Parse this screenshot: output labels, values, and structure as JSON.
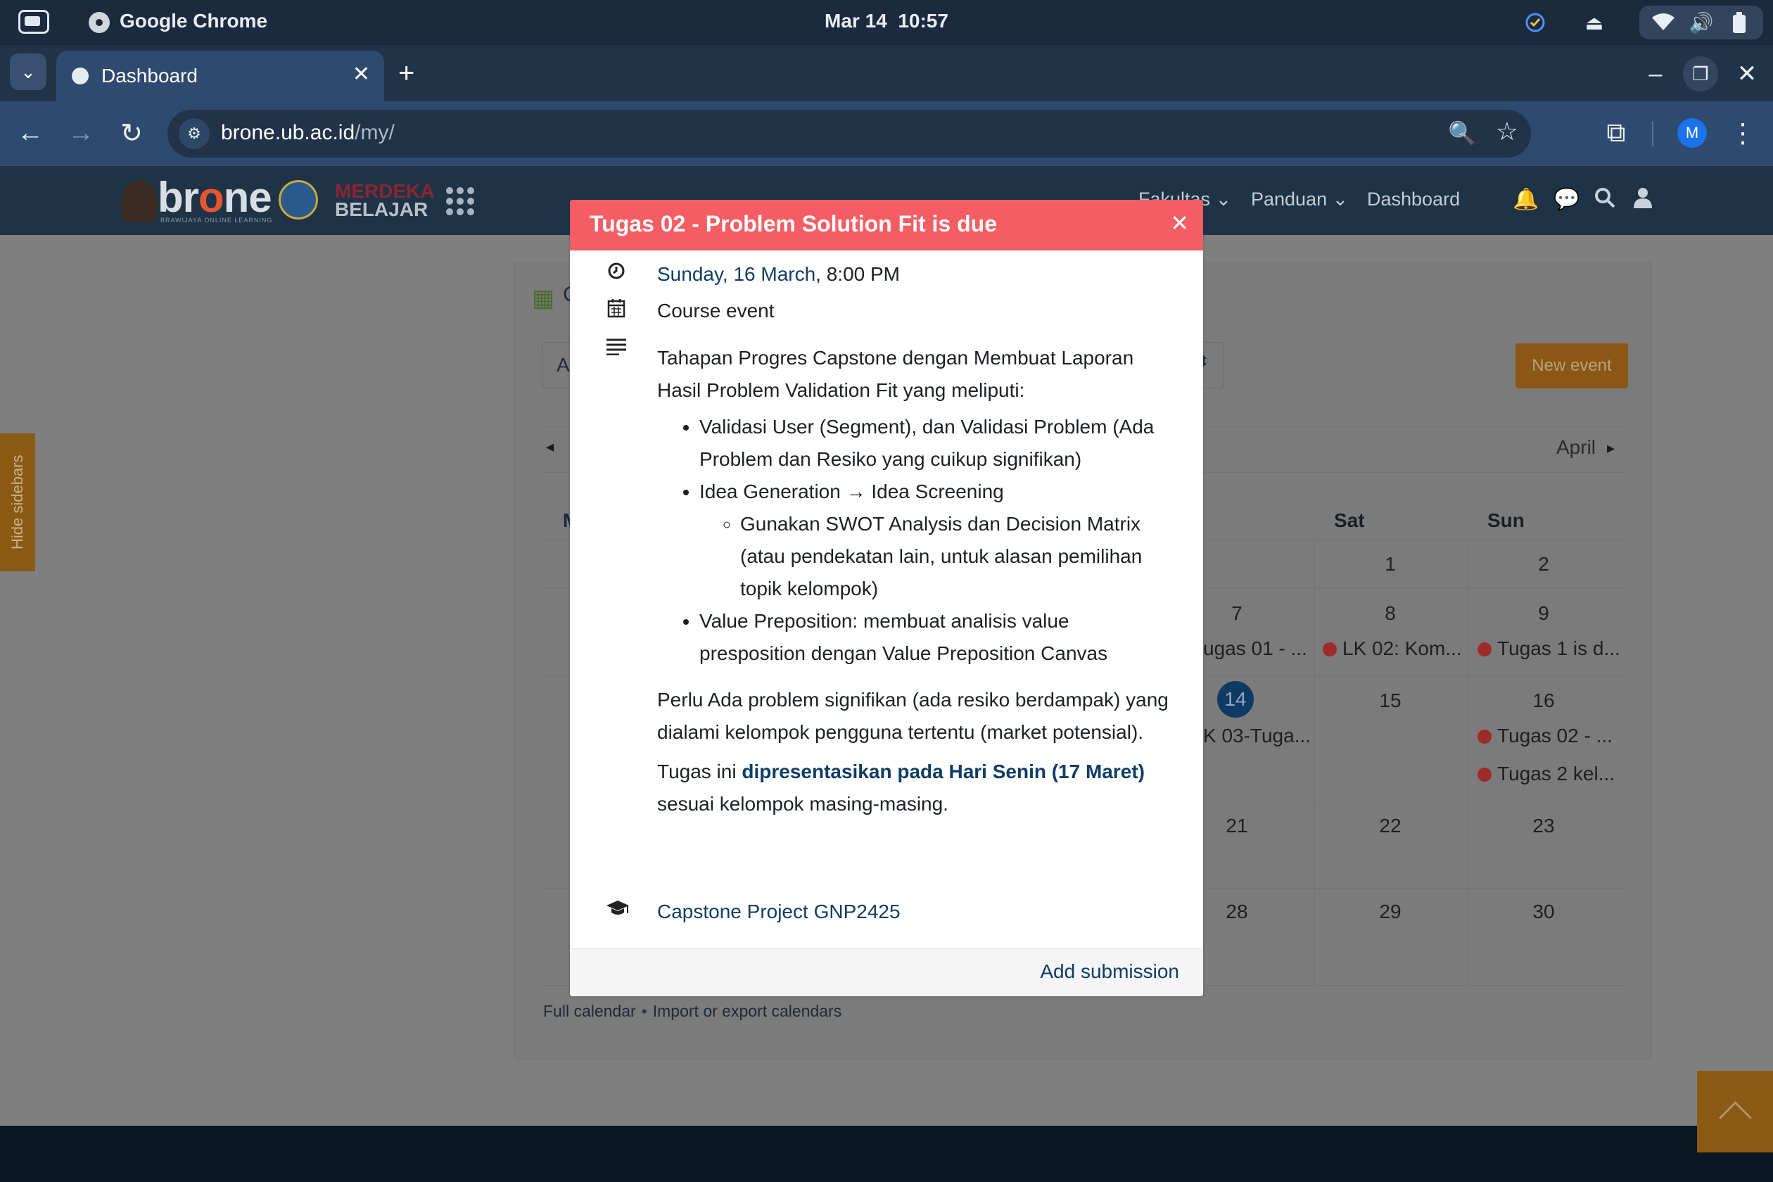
{
  "os": {
    "app_name": "Google Chrome",
    "date": "Mar 14",
    "time": "10:57",
    "icons": [
      "launcher-icon",
      "check-circle-icon",
      "eject-icon",
      "wifi-icon",
      "volume-icon",
      "battery-icon"
    ]
  },
  "browser": {
    "tab_title": "Dashboard",
    "url_host": "brone.ub.ac.id",
    "url_path": "/my/",
    "profile_initial": "M"
  },
  "site": {
    "logo_text_pre": "br",
    "logo_text_o": "o",
    "logo_text_post": "ne",
    "logo_sub": "BRAWIJAYA ONLINE LEARNING",
    "logo_mb_line1": "MERDEKA",
    "logo_mb_line2": "BELAJAR",
    "nav": {
      "fakultas": "Fakultas",
      "panduan": "Panduan",
      "dashboard": "Dashboard"
    }
  },
  "page": {
    "hide_sidebars": "Hide sidebars",
    "calendar_title_trunc": "C",
    "course_select_trunc": "A",
    "new_event": "New event",
    "next_month": "April",
    "day_mon_trunc": "M",
    "days": {
      "sat": "Sat",
      "sun": "Sun"
    },
    "dates": {
      "r1": {
        "sat": "1",
        "sun": "2"
      },
      "r2": {
        "fri": "7",
        "sat": "8",
        "sun": "9"
      },
      "r3": {
        "fri": "14",
        "sat": "15",
        "sun": "16"
      },
      "r4": {
        "fri": "21",
        "sat": "22",
        "sun": "23"
      },
      "r5": {
        "fri": "28",
        "sat": "29",
        "sun": "30"
      }
    },
    "events": {
      "fri7": "ugas 01 - ...",
      "sat8": "LK 02: Kom...",
      "sun9": "Tugas 1 is d...",
      "fri14": "K 03-Tuga...",
      "sun16a": "Tugas 02 - ...",
      "sun16b": "Tugas 2 kel..."
    },
    "full_calendar": "Full calendar",
    "separator": "•",
    "import_export": "Import or export calendars"
  },
  "modal": {
    "title": "Tugas 02 - Problem Solution Fit is due",
    "date_link": "Sunday, 16 March",
    "time": ", 8:00 PM",
    "event_type": "Course event",
    "desc_p1": "Tahapan Progres Capstone dengan Membuat Laporan Hasil Problem Validation Fit yang meliputi:",
    "bullet1": "Validasi User (Segment), dan Validasi Problem (Ada Problem dan Resiko yang cuikup signifikan)",
    "bullet2": "Idea Generation → Idea Screening",
    "sub_bullet": "Gunakan SWOT Analysis dan Decision Matrix (atau pendekatan lain, untuk alasan pemilihan topik kelompok)",
    "bullet3": "Value Preposition: membuat analisis value presposition dengan Value Preposition Canvas",
    "desc_p2": "Perlu Ada problem signifikan (ada resiko berdampak) yang dialami kelompok pengguna tertentu (market potensial).",
    "desc_p3_pre": "Tugas ini ",
    "desc_p3_strong": "dipresentasikan pada Hari Senin (17 Maret)",
    "desc_p3_post": "sesuai kelompok masing-masing.",
    "course_link": "Capstone Project GNP2425",
    "add_submission": "Add submission",
    "colors": {
      "header": "#f55d64",
      "link": "#0f3d66"
    }
  }
}
